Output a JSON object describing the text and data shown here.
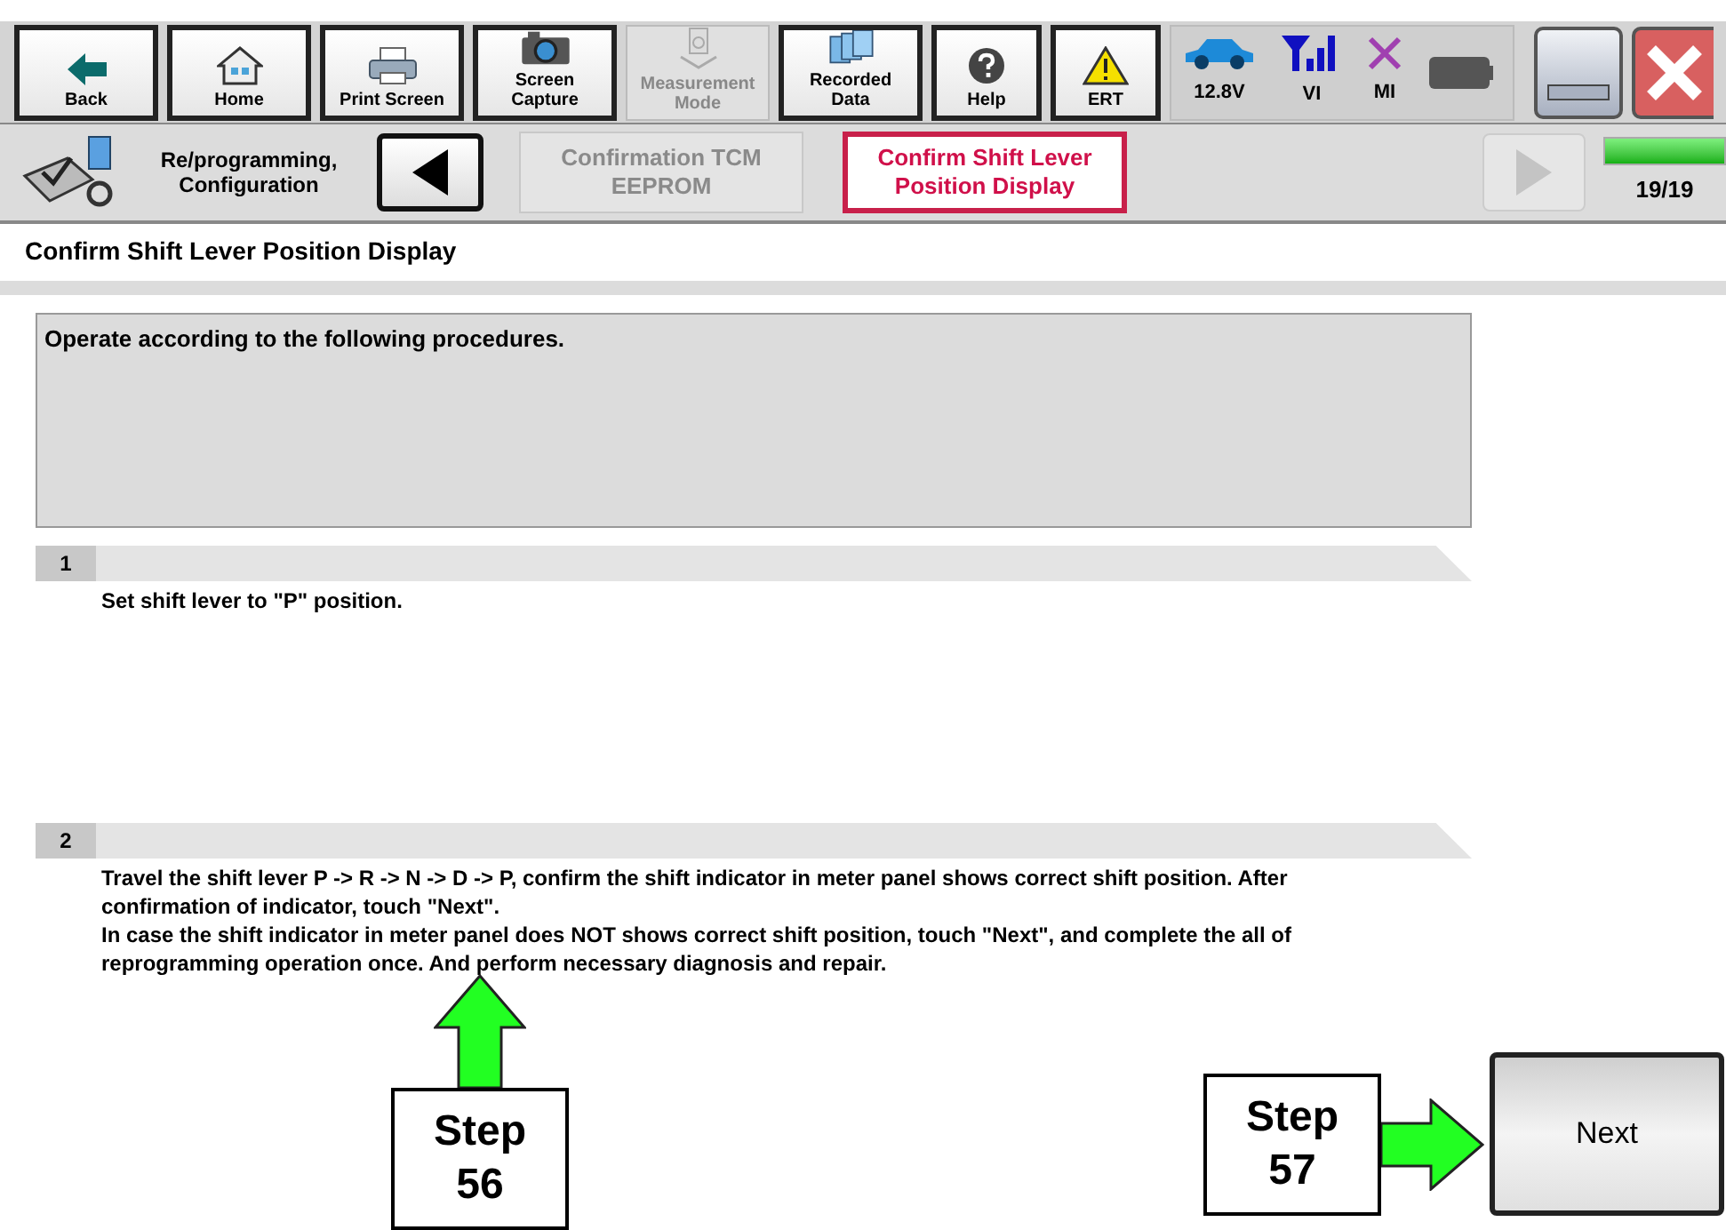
{
  "toolbar": {
    "buttons": [
      {
        "kind": "back",
        "label": "Back",
        "disabled": false
      },
      {
        "kind": "home",
        "label": "Home",
        "disabled": false
      },
      {
        "kind": "print",
        "label": "Print Screen",
        "disabled": false
      },
      {
        "kind": "camera",
        "label": "Screen Capture",
        "disabled": false
      },
      {
        "kind": "meter",
        "label": "Measurement Mode",
        "disabled": true
      },
      {
        "kind": "folders",
        "label": "Recorded Data",
        "disabled": false
      },
      {
        "kind": "help",
        "label": "Help",
        "disabled": false
      },
      {
        "kind": "warning",
        "label": "ERT",
        "disabled": false
      }
    ],
    "status": [
      {
        "kind": "car",
        "label": "12.8V"
      },
      {
        "kind": "signal",
        "label": "VI"
      },
      {
        "kind": "cross",
        "label": "MI"
      },
      {
        "kind": "battery"
      }
    ]
  },
  "breadcrumb": {
    "section": "Re/programming, Configuration",
    "steps": [
      {
        "label": "Confirmation TCM EEPROM",
        "selected": false
      },
      {
        "label": "Confirm Shift Lever Position Display",
        "selected": true
      }
    ],
    "back_disabled": false,
    "next_disabled": true,
    "progress": {
      "level": 1,
      "label": "19/19"
    }
  },
  "page": {
    "title": "Confirm Shift Lever Position Display",
    "instruction": "Operate according to the following procedures.",
    "steps": [
      {
        "number": "1",
        "lines": [
          "Set shift lever to \"P\" position."
        ]
      },
      {
        "number": "2",
        "lines": [
          "Travel the shift lever P -> R -> N -> D -> P, confirm the shift indicator in meter panel shows correct shift position. After confirmation of indicator, touch \"Next\".",
          "In case the shift indicator in meter panel does NOT shows correct shift position, touch \"Next\", and complete the all of reprogramming operation once. And perform necessary diagnosis and repair."
        ]
      }
    ],
    "next_button": "Next"
  },
  "callouts": [
    {
      "kind": "up",
      "line1": "Step",
      "line2": "56"
    },
    {
      "kind": "right",
      "line1": "Step",
      "line2": "57"
    }
  ]
}
